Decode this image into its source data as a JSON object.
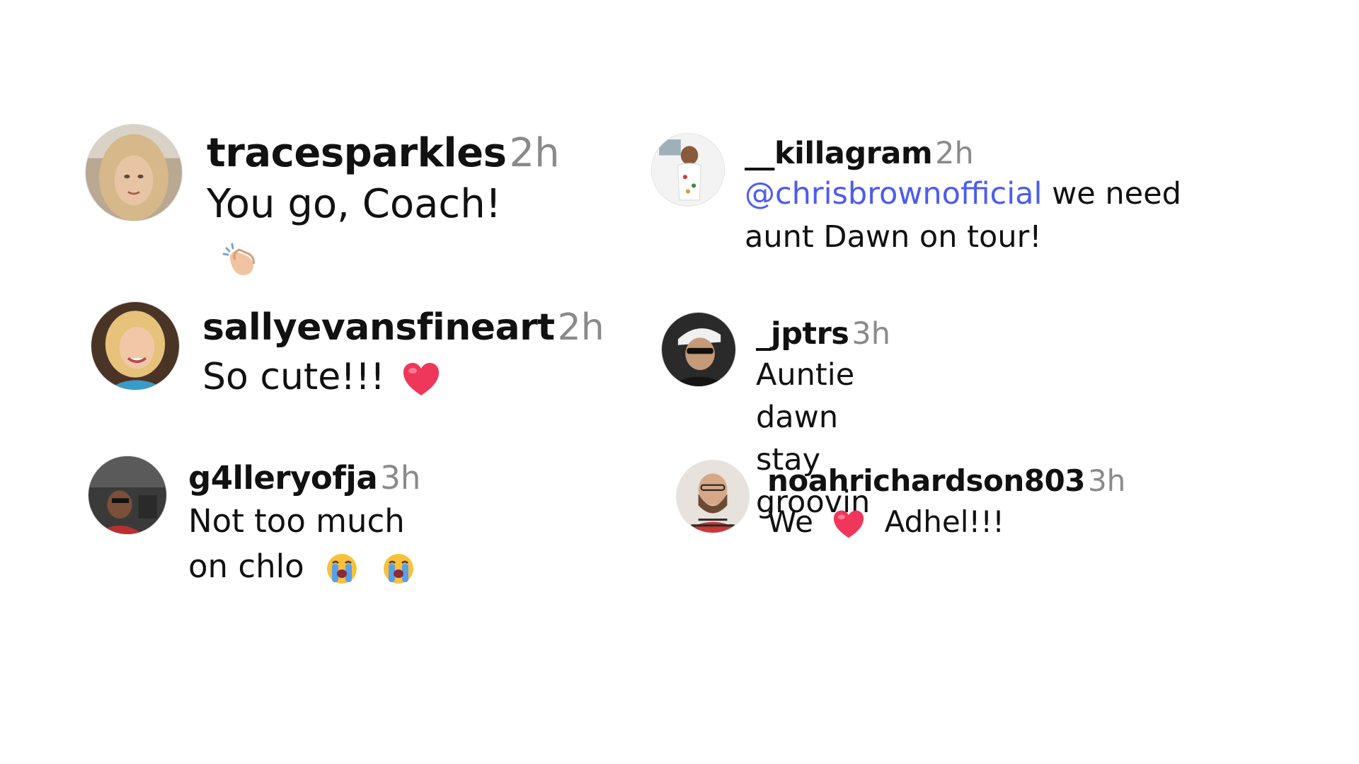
{
  "comments": [
    {
      "username": "tracesparkles",
      "time": "2h",
      "text": "You go, Coach!",
      "emoji_after": [
        "clapping-hands"
      ]
    },
    {
      "username": "__killagram",
      "time": "2h",
      "mention": "@chrisbrownofficial",
      "text": "we need aunt Dawn on tour!"
    },
    {
      "username": "sallyevansfineart",
      "time": "2h",
      "text": "So cute!!!",
      "emoji_after": [
        "red-heart"
      ]
    },
    {
      "username": "_jptrs",
      "time": "3h",
      "text": "Auntie dawn stay groovin"
    },
    {
      "username": "g4lleryofja",
      "time": "3h",
      "text": "Not too much on chlo",
      "emoji_after": [
        "loudly-crying-face",
        "loudly-crying-face"
      ]
    },
    {
      "username": "noahrichardson803",
      "time": "3h",
      "text_before": "We",
      "emoji_middle": "red-heart",
      "text_after": "Adhel!!!"
    }
  ],
  "colors": {
    "username": "#111111",
    "time": "#8a8a8a",
    "mention": "#4c5cf0",
    "heart": "#f0365a"
  }
}
